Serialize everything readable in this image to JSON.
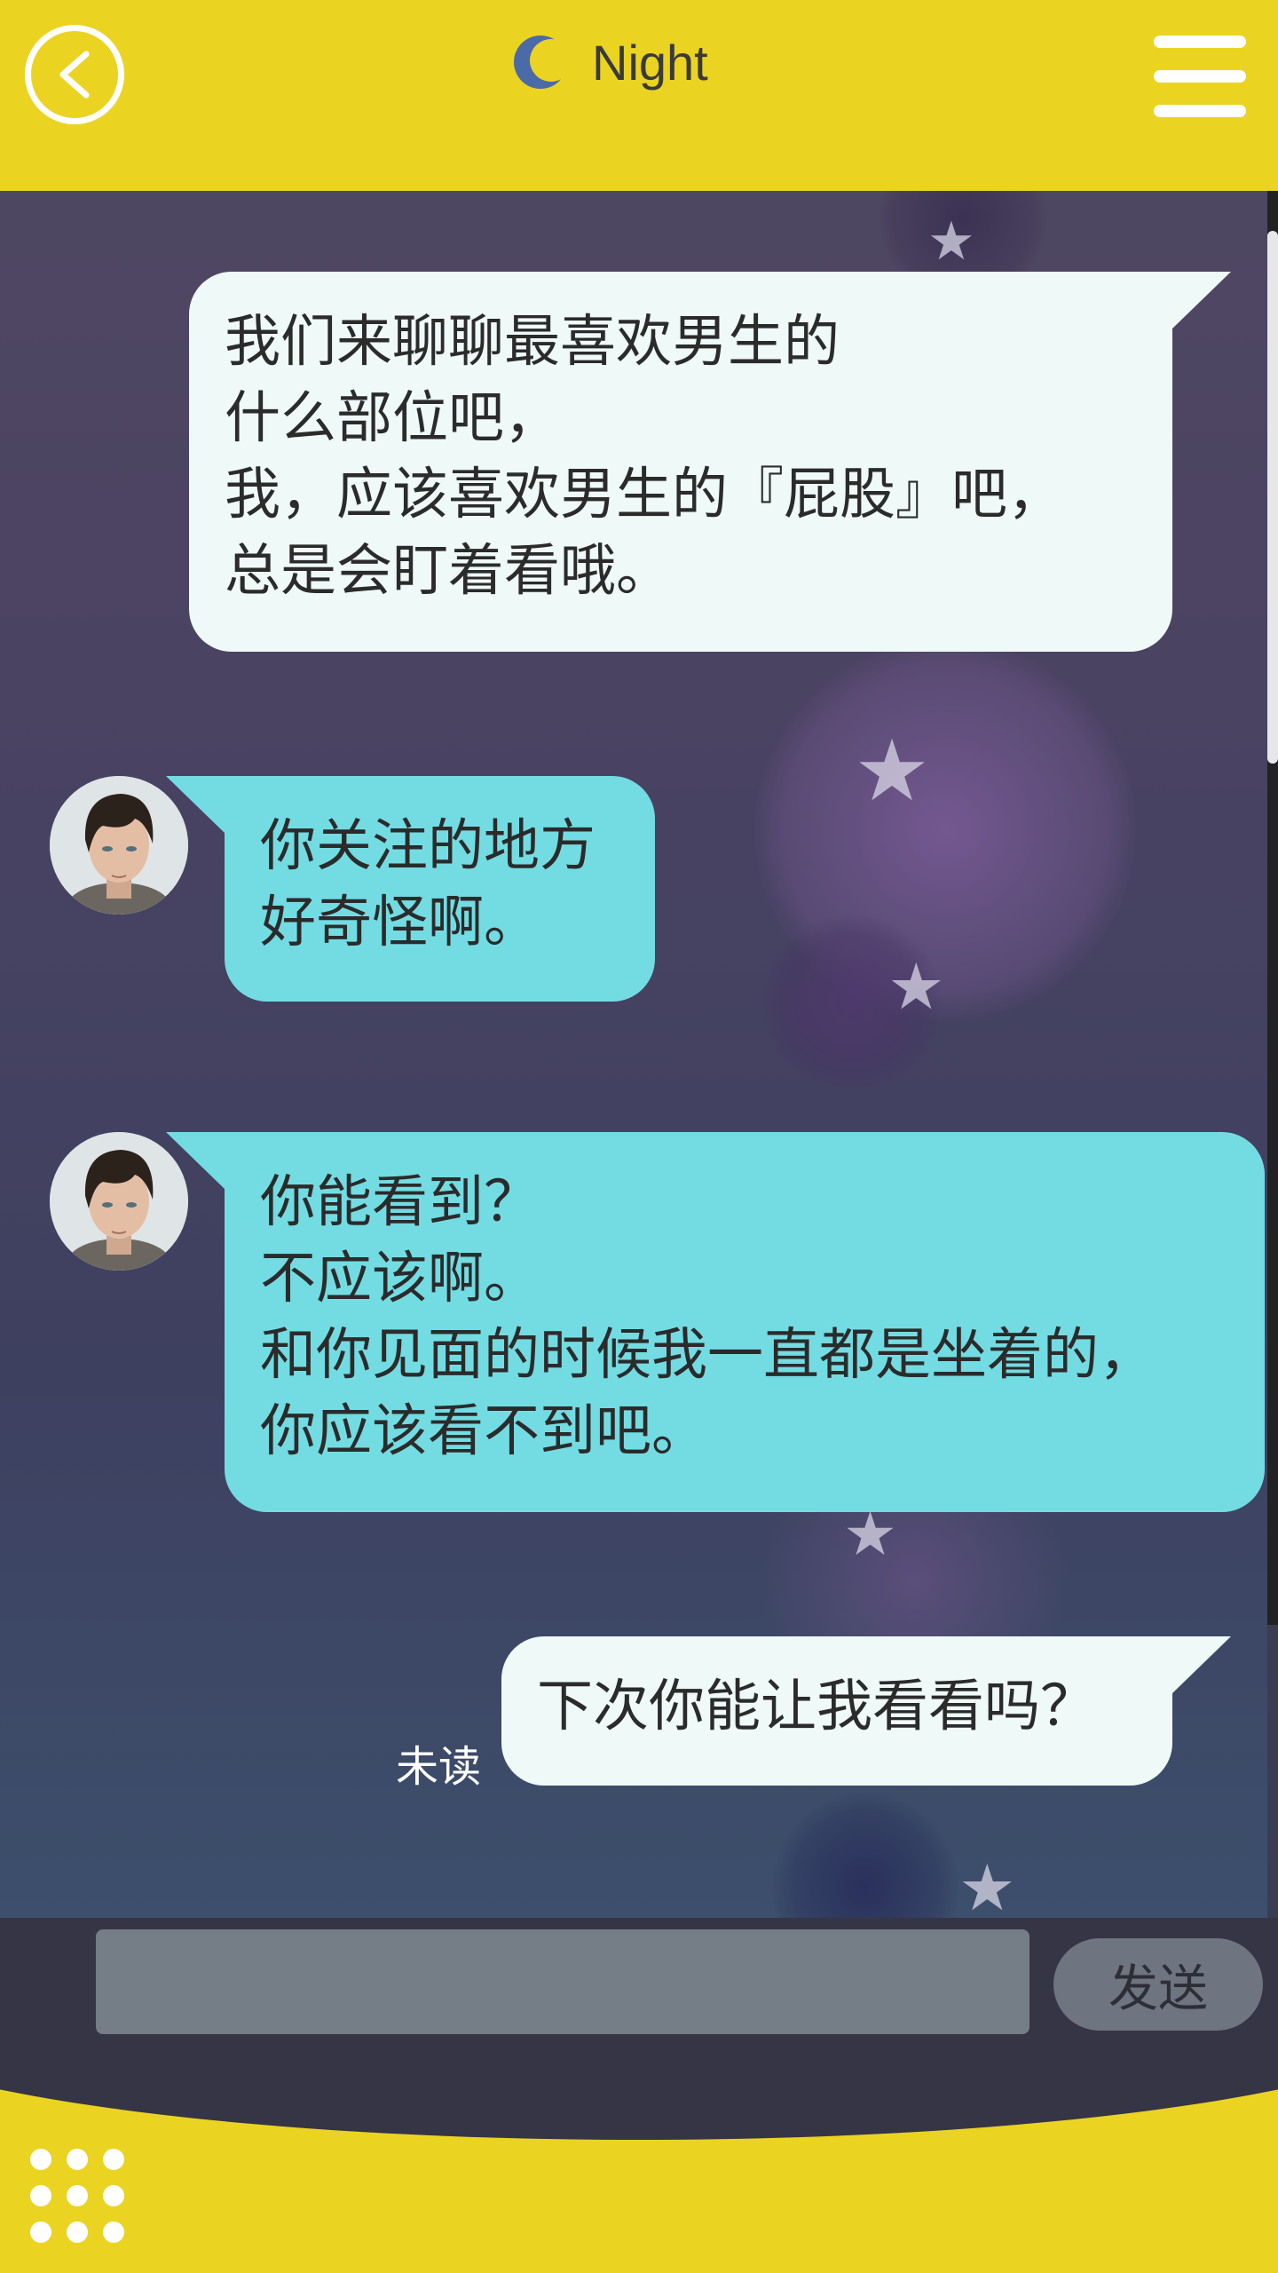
{
  "header": {
    "title": "Night",
    "back_icon": "chevron-left-icon",
    "moon_icon": "moon-icon",
    "menu_icon": "hamburger-menu-icon",
    "accent_color": "#ebd321"
  },
  "messages": [
    {
      "sender": "me",
      "lines": [
        "我们来聊聊最喜欢男生的",
        "什么部位吧，",
        "我，应该喜欢男生的『屁股』吧，",
        "总是会盯着看哦。"
      ]
    },
    {
      "sender": "them",
      "lines": [
        "你关注的地方",
        "好奇怪啊。"
      ]
    },
    {
      "sender": "them",
      "lines": [
        "你能看到？",
        "不应该啊。",
        "和你见面的时候我一直都是坐着的，",
        "你应该看不到吧。"
      ]
    },
    {
      "sender": "me",
      "lines": [
        "下次你能让我看看吗？"
      ],
      "status": "未读"
    }
  ],
  "composer": {
    "input_value": "",
    "send_label": "发送"
  },
  "footer": {
    "grid_icon": "grid-dots-icon"
  },
  "colors": {
    "my_bubble": "#eff9f8",
    "their_bubble": "#73dce3",
    "chat_background": "#4b4362"
  }
}
